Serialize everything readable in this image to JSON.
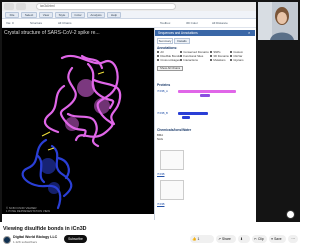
{
  "browser": {
    "url": "icn3d.html"
  },
  "toolbar": {
    "items": [
      "File",
      "Select",
      "View",
      "Style",
      "Color",
      "Analysis",
      "Help"
    ],
    "secondary": [
      "Vie: 0",
      "Structure",
      "All Chains",
      "Toolbox",
      "3D Color",
      "All Distance"
    ]
  },
  "viewer": {
    "title": "Crystal structure of SARS-CoV-2 spike re...",
    "footer_line1": "© NCBI ICN3D VIEWER",
    "footer_line2": "1 POSE REPRESENTATION VIEW"
  },
  "panel": {
    "header": "Sequences and Annotations",
    "tabs": [
      "Summary",
      "Details"
    ],
    "annotations_heading": "Annotations:",
    "checkboxes": [
      "All",
      "Conserved Domains",
      "Disulfide Bonds",
      "Functional Sites",
      "SNPs",
      "Custom",
      "3D Domains",
      "Cross-Linkages",
      "Interactions",
      "ClinVar",
      "Mutations",
      "Glycans"
    ],
    "show_all_chains": "Show All Chains",
    "proteins_heading": "Proteins",
    "seq1_label": "7NNB_A",
    "seq2_label": "7NNB_B",
    "chem_heading": "Chemicals/Ions/Water",
    "chem_items": [
      "BMA",
      "NAG"
    ],
    "links": [
      "7NNB",
      "7NNB"
    ]
  },
  "video": {
    "title": "Viewing disulfide bonds in iCn3D",
    "channel": "Digital World Biology LLC",
    "subscribers": "1.12K subscribers",
    "subscribe_label": "Subscribe",
    "likes": "1",
    "share_label": "Share",
    "download_label": "Download",
    "clip_label": "Clip",
    "save_label": "Save"
  },
  "colors": {
    "protein_magenta": "#e066e8",
    "protein_blue": "#2a3fd6",
    "disulfide_yellow": "#f2e23a"
  }
}
